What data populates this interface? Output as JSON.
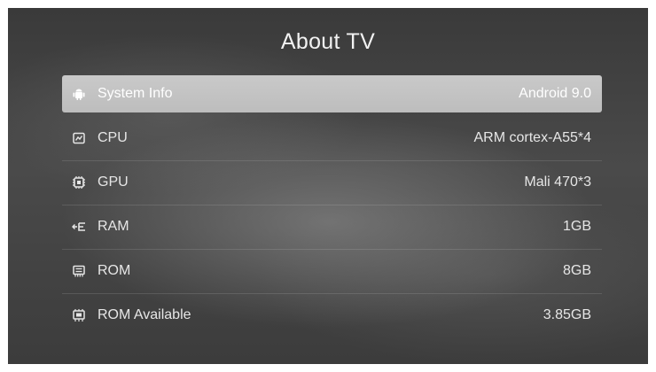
{
  "title": "About TV",
  "rows": [
    {
      "label": "System Info",
      "value": "Android 9.0",
      "icon": "android-icon"
    },
    {
      "label": "CPU",
      "value": "ARM cortex-A55*4",
      "icon": "cpu-icon"
    },
    {
      "label": "GPU",
      "value": "Mali 470*3",
      "icon": "gpu-chip-icon"
    },
    {
      "label": "RAM",
      "value": "1GB",
      "icon": "ram-icon"
    },
    {
      "label": "ROM",
      "value": "8GB",
      "icon": "rom-icon"
    },
    {
      "label": "ROM Available",
      "value": "3.85GB",
      "icon": "rom-available-icon"
    }
  ],
  "colors": {
    "focused_row": "#c4c4c4",
    "text": "#e6e6e6"
  }
}
